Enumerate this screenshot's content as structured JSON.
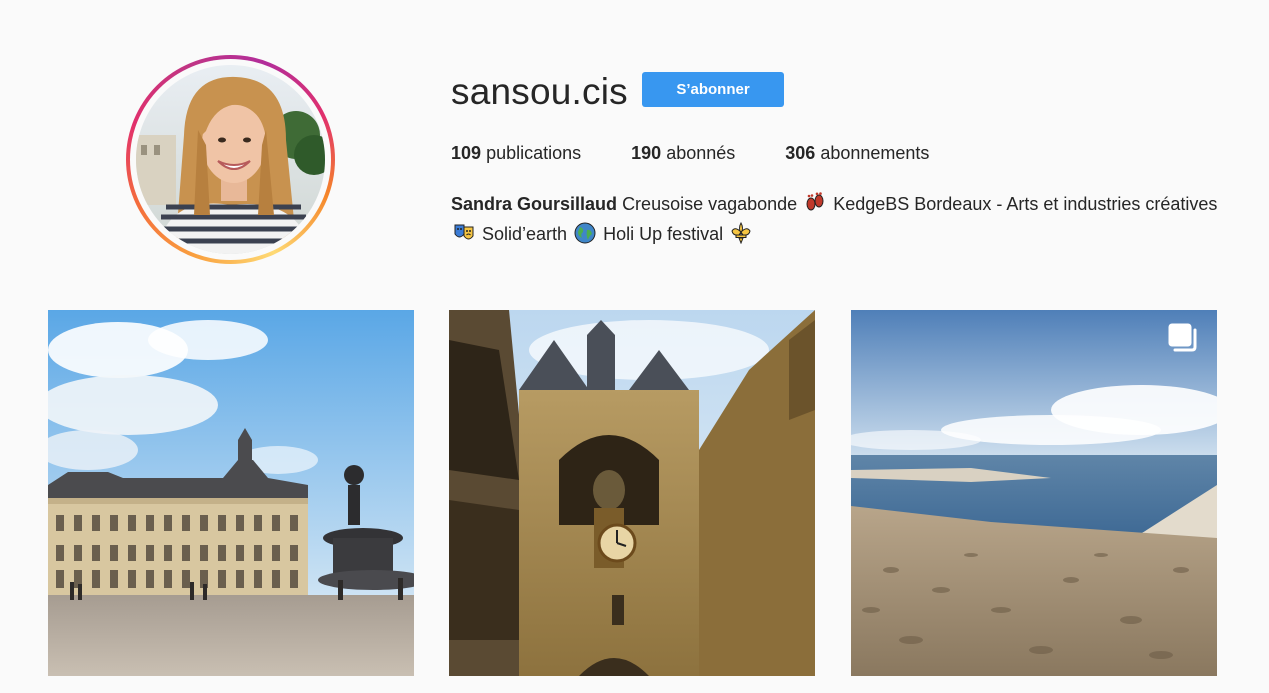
{
  "profile": {
    "username": "sansou.cis",
    "follow_label": "S’abonner",
    "stats": {
      "publications_count": "109",
      "publications_label": "publications",
      "followers_count": "190",
      "followers_label": "abonnés",
      "following_count": "306",
      "following_label": "abonnements"
    },
    "bio": {
      "name": "Sandra Goursillaud",
      "part1": "Creusoise vagabonde",
      "part2": "KedgeBS Bordeaux - Arts et industries créatives",
      "part3": "Solid’earth",
      "part4": "Holi Up festival"
    }
  },
  "icons": {
    "emoji_1": "footprints-icon",
    "emoji_2": "performing-arts-icon",
    "emoji_3": "globe-icon",
    "emoji_4": "fleur-de-lis-icon",
    "multi_post": "carousel-icon"
  },
  "colors": {
    "accent": "#3897f0",
    "text": "#262626",
    "background": "#fafafa"
  },
  "posts": [
    {
      "subject": "Place de la Bourse with fountain"
    },
    {
      "subject": "Grosse Cloche gate with clock"
    },
    {
      "subject": "Dune du Pilat sand and sea",
      "multiple": true
    }
  ]
}
